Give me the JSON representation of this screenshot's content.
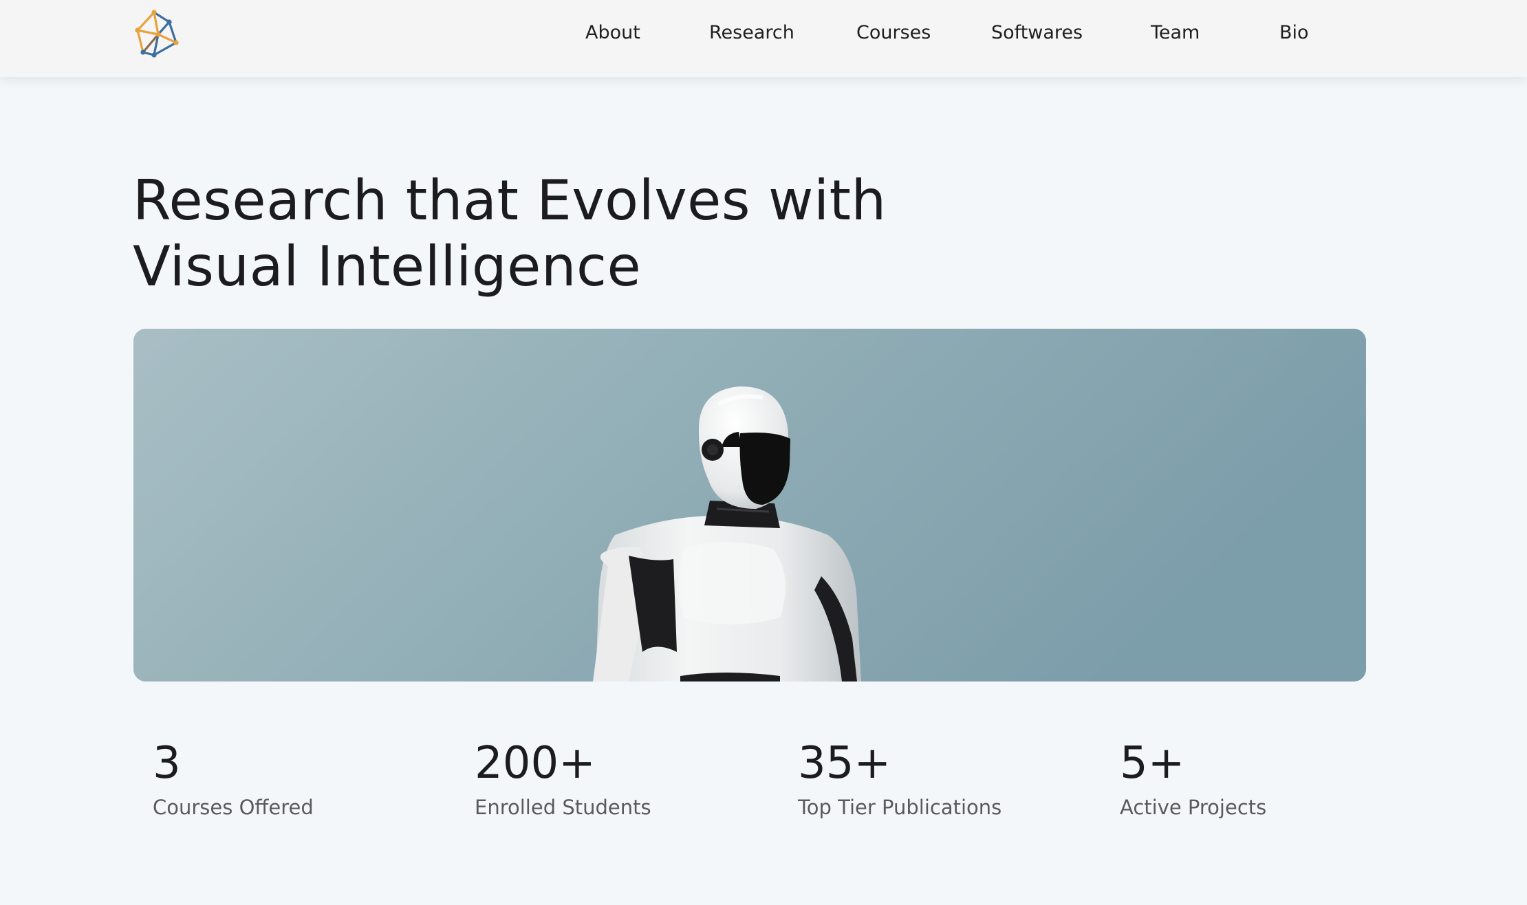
{
  "header": {
    "logo_icon": "network-cube-logo-icon",
    "nav": [
      {
        "label": "About"
      },
      {
        "label": "Research"
      },
      {
        "label": "Courses"
      },
      {
        "label": "Softwares"
      },
      {
        "label": "Team"
      },
      {
        "label": "Bio"
      }
    ]
  },
  "hero": {
    "title_line1": "Research that Evolves with",
    "title_line2": "Visual Intelligence",
    "image_subject": "humanoid-robot-image"
  },
  "stats": [
    {
      "value": "3",
      "label": "Courses Offered"
    },
    {
      "value": "200+",
      "label": "Enrolled Students"
    },
    {
      "value": "35+",
      "label": "Top Tier Publications"
    },
    {
      "value": "5+",
      "label": "Active Projects"
    }
  ],
  "colors": {
    "background": "#f4f7fa",
    "header_bg": "#f5f5f5",
    "sky": "#8eaab3",
    "logo_orange": "#e8a23c",
    "logo_blue": "#3b6fa0"
  }
}
